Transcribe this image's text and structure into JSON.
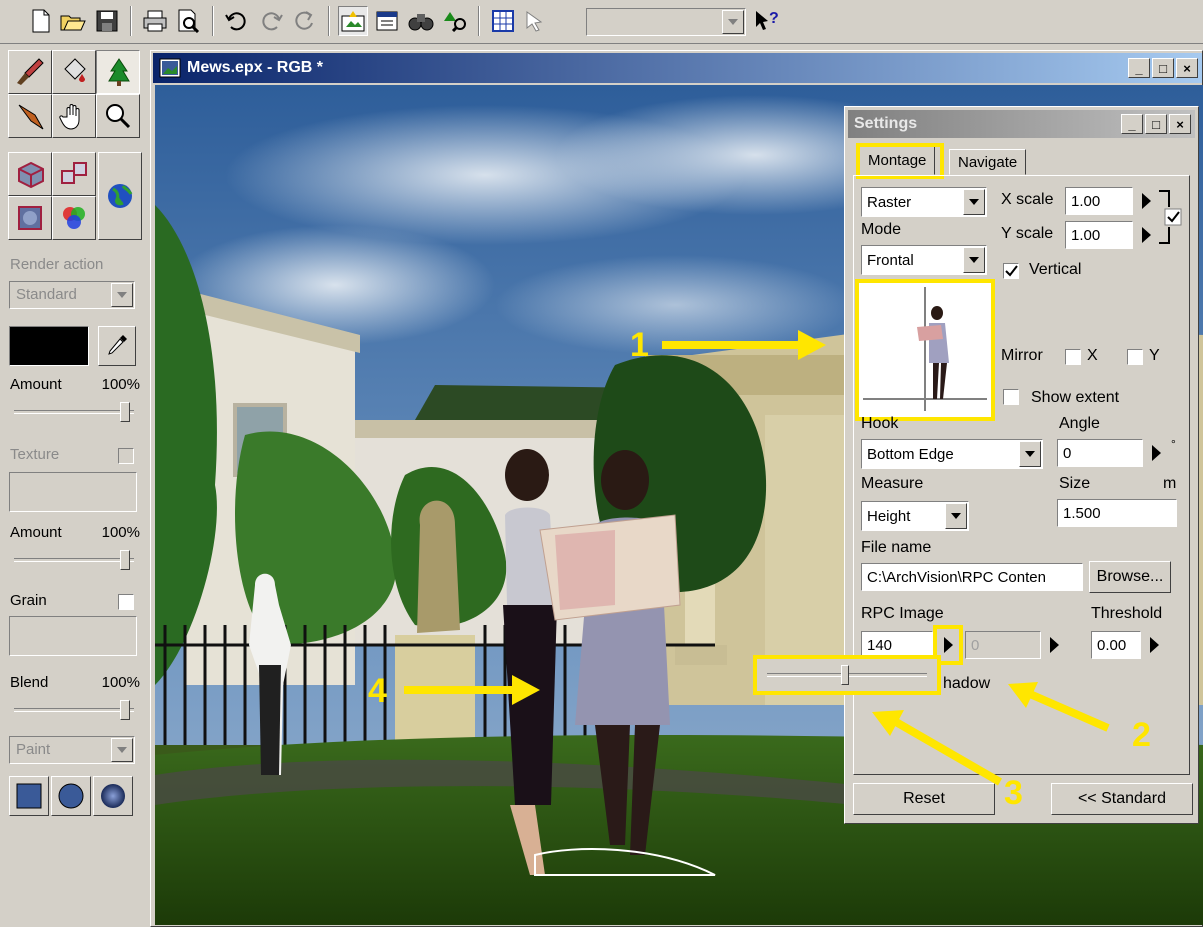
{
  "toolbar": {
    "icons": [
      "new-icon",
      "open-icon",
      "save-icon",
      "print-icon",
      "print-preview-icon",
      "undo-icon",
      "redo-icon",
      "repeat-icon",
      "montage-icon",
      "calendar-icon",
      "binoculars-icon",
      "tree-search-icon",
      "grid-icon",
      "pointer-icon",
      "help-pointer-icon"
    ],
    "combo_value": ""
  },
  "palette": {
    "render_action_label": "Render action",
    "render_action_value": "Standard",
    "amount1_label": "Amount",
    "amount1_value": "100%",
    "amount1_level": 1.0,
    "texture_label": "Texture",
    "amount2_label": "Amount",
    "amount2_value": "100%",
    "grain_label": "Grain",
    "blend_label": "Blend",
    "blend_value": "100%",
    "paint_value": "Paint",
    "color_swatch": "#000000"
  },
  "document": {
    "title": "Mews.epx - RGB *",
    "minimize": "_",
    "maximize": "□",
    "close": "×"
  },
  "settings": {
    "title": "Settings",
    "tabs": [
      "Montage",
      "Navigate"
    ],
    "active_tab": "Montage",
    "type_value": "Raster",
    "x_scale_label": "X scale",
    "x_scale_value": "1.00",
    "y_scale_label": "Y scale",
    "y_scale_value": "1.00",
    "mode_label": "Mode",
    "mode_value": "Frontal",
    "vertical_label": "Vertical",
    "vertical_checked": true,
    "mirror_label": "Mirror",
    "mirror_x_label": "X",
    "mirror_y_label": "Y",
    "show_extent_label": "Show extent",
    "hook_label": "Hook",
    "hook_value": "Bottom Edge",
    "angle_label": "Angle",
    "angle_value": "0",
    "angle_unit": "°",
    "measure_label": "Measure",
    "measure_value": "Height",
    "size_label": "Size",
    "size_unit": "m",
    "size_value": "1.500",
    "file_name_label": "File name",
    "file_name_value": "C:\\ArchVision\\RPC Conten",
    "browse_label": "Browse...",
    "rpc_image_label": "RPC Image",
    "rpc_image_value": "140",
    "rpc_image_value2": "0",
    "threshold_label": "Threshold",
    "threshold_value": "0.00",
    "shadow_label": "hadow",
    "rpc_slider_level": 0.48,
    "reset_label": "Reset",
    "standard_label": "<< Standard"
  },
  "annotations": {
    "n1": "1",
    "n2": "2",
    "n3": "3",
    "n4": "4",
    "color": "#ffe600"
  }
}
